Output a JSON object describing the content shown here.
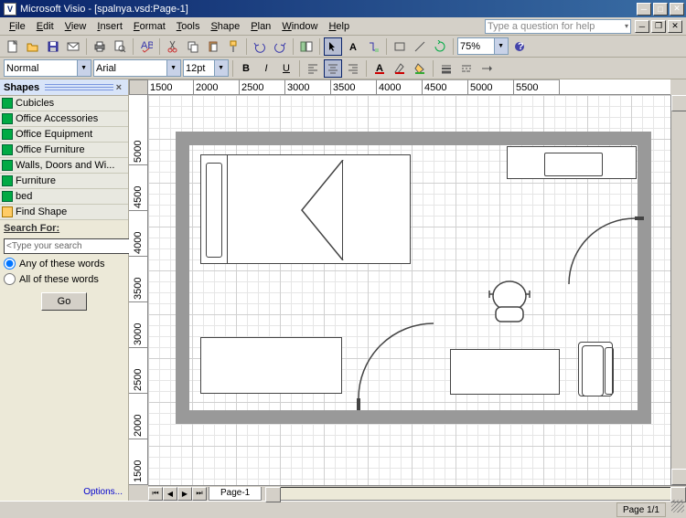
{
  "titlebar": {
    "app": "Microsoft Visio",
    "doc": "[spalnya.vsd:Page-1]"
  },
  "menus": [
    "File",
    "Edit",
    "View",
    "Insert",
    "Format",
    "Tools",
    "Shape",
    "Plan",
    "Window",
    "Help"
  ],
  "help_placeholder": "Type a question for help",
  "zoom": "75%",
  "format": {
    "style": "Normal",
    "font": "Arial",
    "size": "12pt"
  },
  "shapes": {
    "title": "Shapes",
    "stencils": [
      "Cubicles",
      "Office Accessories",
      "Office Equipment",
      "Office Furniture",
      "Walls, Doors and Wi...",
      "Furniture",
      "bed",
      "Find Shape"
    ],
    "search_label": "Search For:",
    "search_placeholder": "<Type your search",
    "radio_any": "Any of these words",
    "radio_all": "All of these words",
    "go": "Go",
    "options": "Options..."
  },
  "ruler_h": [
    "1500",
    "2000",
    "2500",
    "3000",
    "3500",
    "4000",
    "4500",
    "5000",
    "5500"
  ],
  "ruler_v": [
    "1500",
    "2000",
    "2500",
    "3000",
    "3500",
    "4000",
    "4500",
    "5000"
  ],
  "page_tab": "Page-1",
  "status": "Page 1/1"
}
